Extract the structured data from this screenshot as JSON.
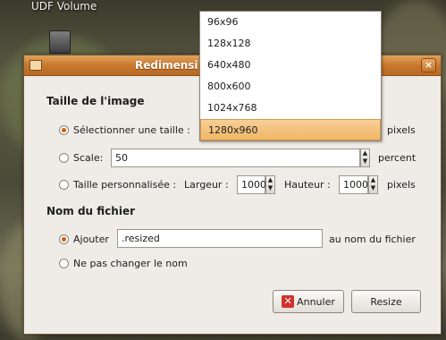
{
  "desktop": {
    "volume_label": "UDF Volume"
  },
  "dialog": {
    "title": "Redimensi",
    "close_glyph": "×",
    "image_size": {
      "heading": "Taille de l'image",
      "select_size_label": "Sélectionner une taille :",
      "pixels_label_1": "pixels",
      "scale_label": "Scale:",
      "scale_value": "50",
      "percent_label": "percent",
      "custom_label": "Taille personnalisée :",
      "width_label": "Largeur :",
      "width_value": "1000",
      "height_label": "Hauteur :",
      "height_value": "1000",
      "pixels_label_2": "pixels",
      "selected_option": "select_size"
    },
    "filename": {
      "heading": "Nom du fichier",
      "append_label": "Ajouter",
      "append_value": ".resized",
      "suffix_label": "au nom du fichier",
      "no_change_label": "Ne pas changer le nom",
      "selected_option": "append"
    },
    "buttons": {
      "cancel_label": "Annuler",
      "resize_label": "Resize"
    }
  },
  "size_dropdown": {
    "options": [
      "96x96",
      "128x128",
      "640x480",
      "800x600",
      "1024x768",
      "1280x960"
    ],
    "selected": "1280x960"
  },
  "colors": {
    "titlebar": "#c9782e",
    "selection": "#f0b665",
    "radio_dot": "#d75b12",
    "cancel_icon": "#d2332a"
  },
  "icons": {
    "close": "close-icon",
    "cancel": "cancel-x-icon",
    "window": "window-icon",
    "spin_up": "spin-up-arrow-icon",
    "spin_down": "spin-down-arrow-icon"
  }
}
